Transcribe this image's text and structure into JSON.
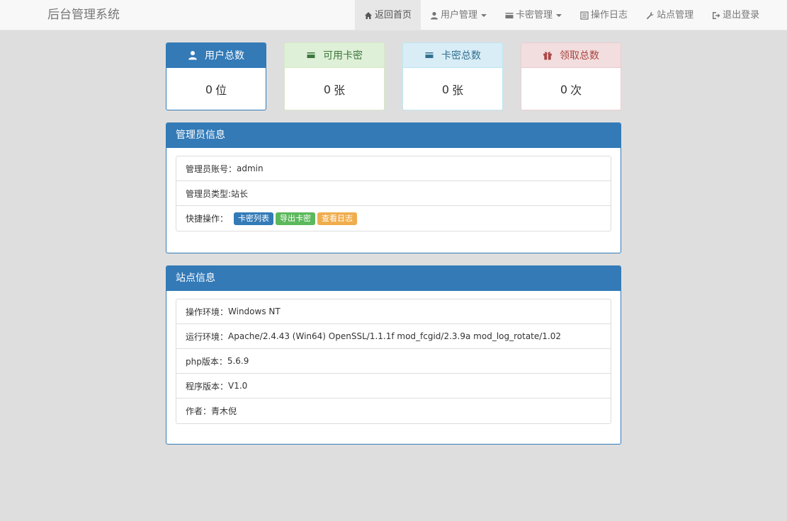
{
  "navbar": {
    "brand": "后台管理系统",
    "items": [
      {
        "label": "返回首页",
        "icon": "home-icon"
      },
      {
        "label": "用户管理",
        "icon": "user-icon"
      },
      {
        "label": "卡密管理",
        "icon": "credit-card-icon"
      },
      {
        "label": "操作日志",
        "icon": "list-alt-icon"
      },
      {
        "label": "站点管理",
        "icon": "wrench-icon"
      },
      {
        "label": "退出登录",
        "icon": "log-out-icon"
      }
    ]
  },
  "stats": [
    {
      "title": "用户总数",
      "value": "0",
      "unit": "位",
      "icon": "user-icon"
    },
    {
      "title": "可用卡密",
      "value": "0",
      "unit": "张",
      "icon": "credit-card-icon"
    },
    {
      "title": "卡密总数",
      "value": "0",
      "unit": "张",
      "icon": "credit-card-icon"
    },
    {
      "title": "领取总数",
      "value": "0",
      "unit": "次",
      "icon": "gift-icon"
    }
  ],
  "admin": {
    "title": "管理员信息",
    "account_label": "管理员账号：",
    "account": "admin",
    "type_label": "管理员类型: ",
    "type": "站长",
    "quick_label": "快捷操作：",
    "quick": [
      "卡密列表",
      "导出卡密",
      "查看日志"
    ]
  },
  "site": {
    "title": "站点信息",
    "rows": [
      {
        "label": "操作环境：",
        "value": "Windows NT"
      },
      {
        "label": "运行环境：",
        "value": "Apache/2.4.43 (Win64) OpenSSL/1.1.1f mod_fcgid/2.3.9a mod_log_rotate/1.02"
      },
      {
        "label": "php版本：",
        "value": "5.6.9"
      },
      {
        "label": "程序版本：",
        "value": "V1.0"
      },
      {
        "label": "作者：",
        "value": "青木倪"
      }
    ]
  },
  "colors": {
    "primary": "#337ab7",
    "success": "#5cb85c",
    "warning": "#f0ad4e",
    "background": "#dedede"
  }
}
